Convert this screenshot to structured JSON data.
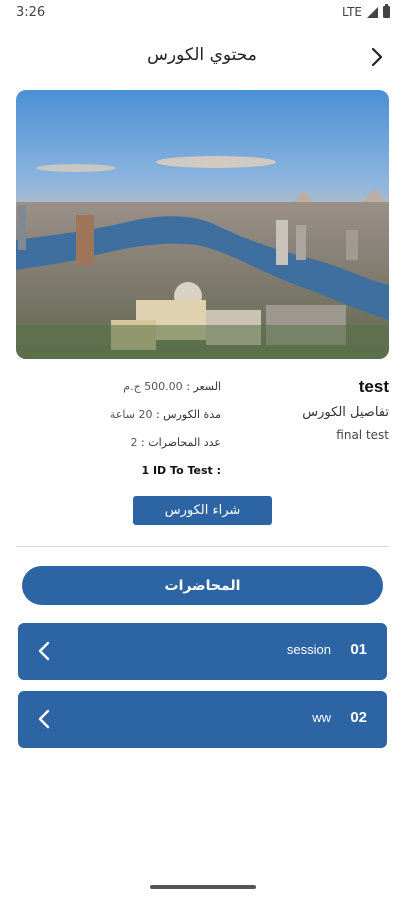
{
  "status_bar": {
    "time": "3:26",
    "network": "LTE"
  },
  "app_bar": {
    "title": "محتوي الكورس"
  },
  "course": {
    "name": "test",
    "details_label": "تفاصيل الكورس",
    "description": "final test",
    "price_label": "السعر :",
    "price_value": "500.00 ج.م",
    "duration_label": "مدة الكورس :",
    "duration_value": "20 ساعة",
    "lectures_count_label": "عدد المحاضرات :",
    "lectures_count_value": "2",
    "id_label": "ID To Test :",
    "id_value": "1"
  },
  "buy_button": {
    "label": "شراء الكورس"
  },
  "lectures_button": {
    "label": "المحاضرات"
  },
  "sessions": [
    {
      "number": "01",
      "title": "session"
    },
    {
      "number": "02",
      "title": "ww"
    }
  ],
  "colors": {
    "primary": "#2d64a3"
  }
}
